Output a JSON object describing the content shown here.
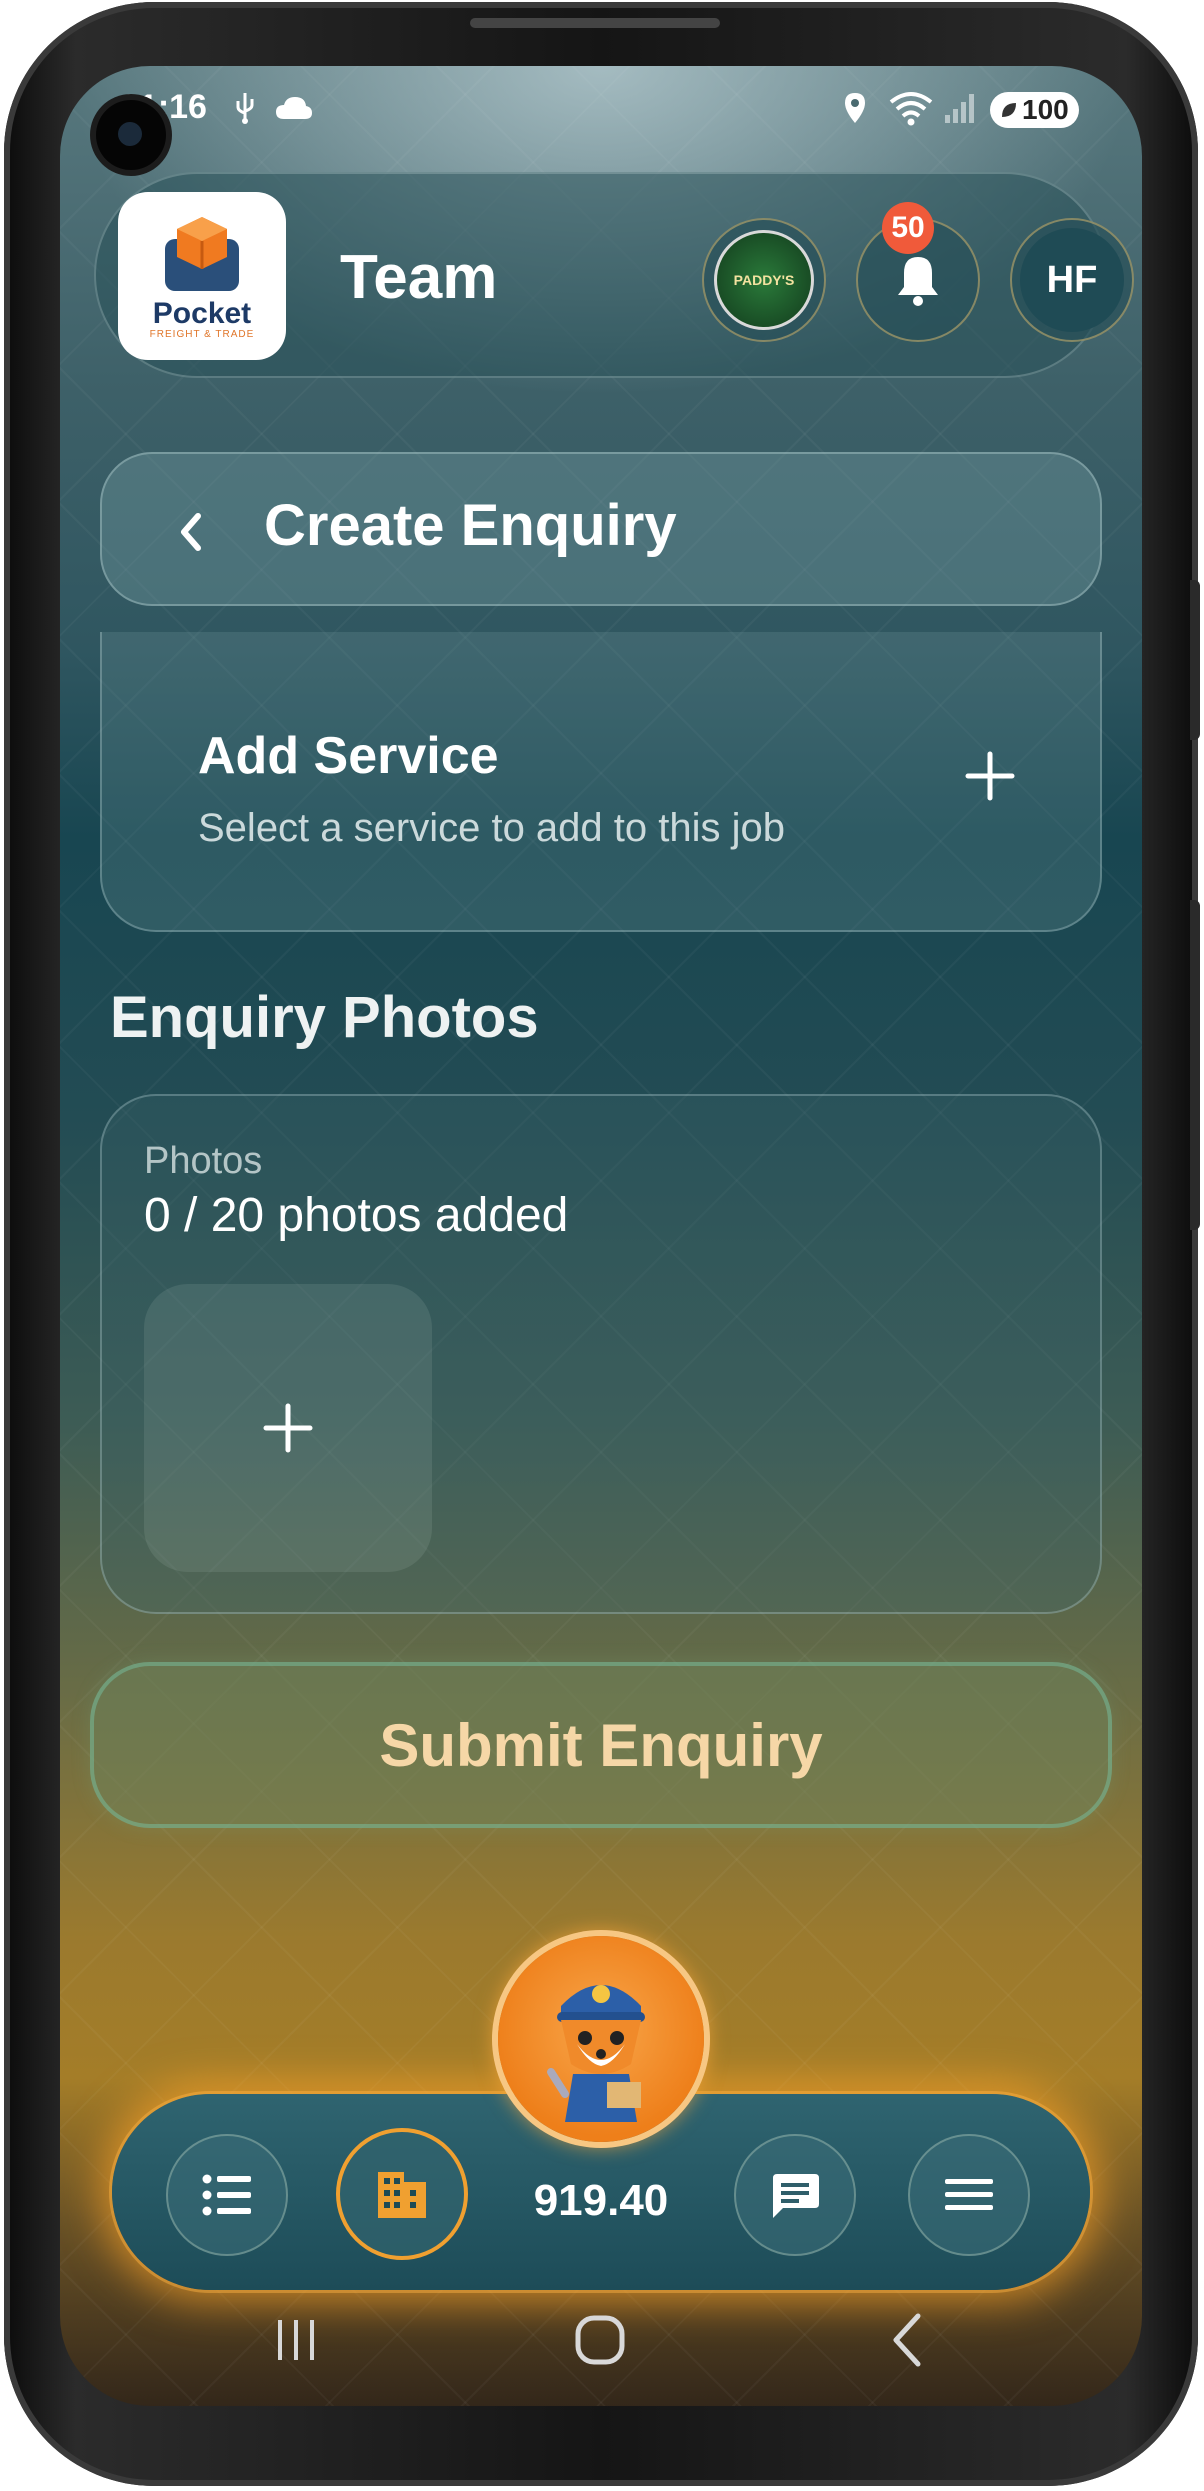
{
  "status_bar": {
    "time": "21:16",
    "battery": "100"
  },
  "header": {
    "title": "Team",
    "logo_title": "Pocket",
    "logo_subtitle": "FREIGHT & TRADE",
    "company_badge_text": "PADDY'S",
    "notification_count": "50",
    "avatar_initials": "HF"
  },
  "page": {
    "title": "Create Enquiry"
  },
  "service": {
    "title": "Add Service",
    "subtitle": "Select a service to add to this job"
  },
  "photos": {
    "section_title": "Enquiry Photos",
    "label": "Photos",
    "count_text": "0 / 20 photos added"
  },
  "submit": {
    "label": "Submit Enquiry"
  },
  "bottom_nav": {
    "coin_value": "919.40",
    "items": [
      {
        "icon": "list-icon"
      },
      {
        "icon": "building-icon",
        "active": true
      },
      {
        "icon": "mascot-icon"
      },
      {
        "icon": "chat-icon"
      },
      {
        "icon": "menu-icon"
      }
    ]
  },
  "colors": {
    "accent": "#f0a030",
    "badge": "#f05a3a",
    "submit_text": "#f6d7a7"
  }
}
